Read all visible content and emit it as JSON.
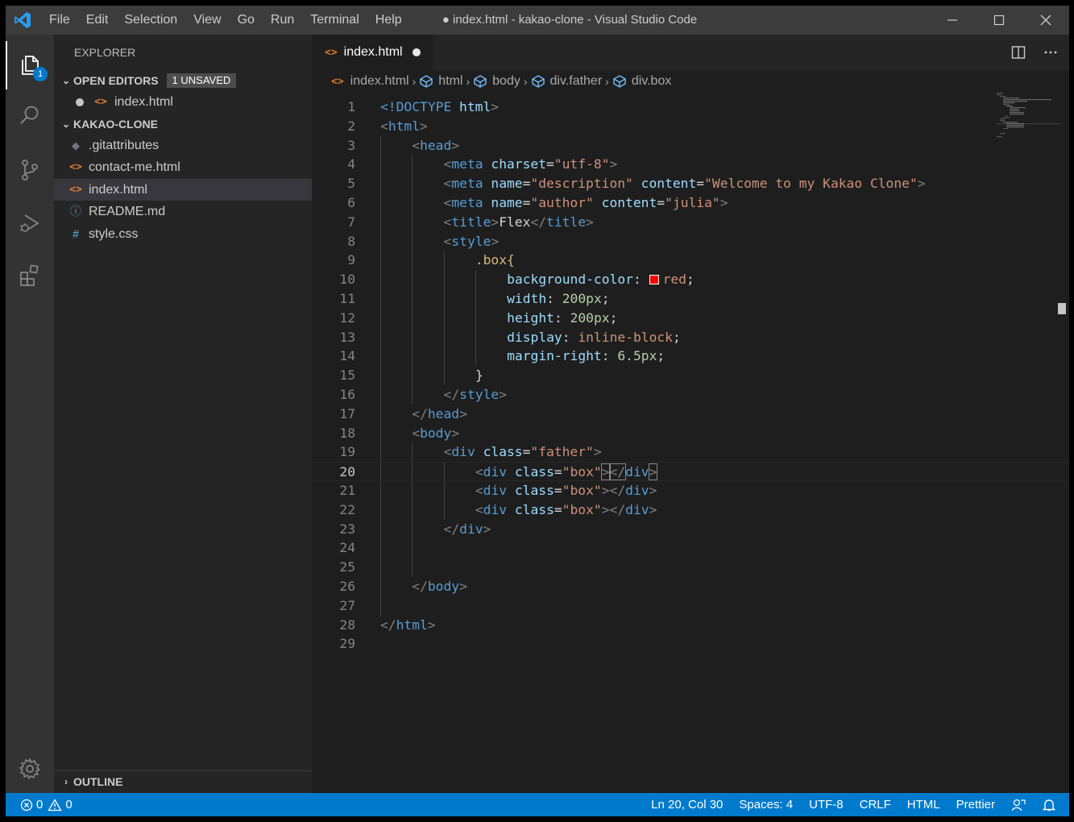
{
  "window": {
    "title": "● index.html - kakao-clone - Visual Studio Code",
    "menu": [
      "File",
      "Edit",
      "Selection",
      "View",
      "Go",
      "Run",
      "Terminal",
      "Help"
    ]
  },
  "activity_bar": {
    "items": [
      "files-icon",
      "search-icon",
      "source-control-icon",
      "run-debug-icon",
      "extensions-icon"
    ],
    "explorer_badge": "1",
    "bottom": "gear-icon"
  },
  "sidebar": {
    "title": "EXPLORER",
    "open_editors": {
      "label": "OPEN EDITORS",
      "badge": "1 UNSAVED",
      "files": [
        {
          "name": "index.html",
          "dirty": true
        }
      ]
    },
    "folder": {
      "label": "KAKAO-CLONE",
      "files": [
        {
          "name": ".gitattributes",
          "icon": "git-file-icon"
        },
        {
          "name": "contact-me.html",
          "icon": "html-file-icon"
        },
        {
          "name": "index.html",
          "icon": "html-file-icon",
          "selected": true
        },
        {
          "name": "README.md",
          "icon": "info-file-icon"
        },
        {
          "name": "style.css",
          "icon": "css-file-icon"
        }
      ]
    },
    "outline_label": "OUTLINE"
  },
  "editor": {
    "tab": {
      "label": "index.html",
      "dirty": true
    },
    "breadcrumb": [
      "index.html",
      "html",
      "body",
      "div.father",
      "div.box"
    ],
    "line_numbers": [
      "1",
      "2",
      "3",
      "4",
      "5",
      "6",
      "7",
      "8",
      "9",
      "10",
      "11",
      "12",
      "13",
      "14",
      "15",
      "16",
      "17",
      "18",
      "19",
      "20",
      "21",
      "22",
      "23",
      "24",
      "25",
      "26",
      "27",
      "28",
      "29"
    ],
    "current_line": 20,
    "code": [
      {
        "t": "<!DOCTYPE",
        "c": "punc-tag"
      },
      {
        "t": "html",
        "c": "attr"
      },
      {
        "t": "html",
        "c": "tag"
      },
      {
        "t": "head",
        "c": "tag"
      },
      {
        "t": "meta",
        "c": "tag"
      },
      {
        "t": "charset",
        "c": "attr"
      },
      {
        "t": "\"utf-8\"",
        "c": "str"
      },
      {
        "t": "name",
        "c": "attr"
      },
      {
        "t": "\"description\"",
        "c": "str"
      },
      {
        "t": "content",
        "c": "attr"
      },
      {
        "t": "\"Welcome to my Kakao Clone\"",
        "c": "str"
      },
      {
        "t": "\"author\"",
        "c": "str"
      },
      {
        "t": "\"julia\"",
        "c": "str"
      },
      {
        "t": "title",
        "c": "tag"
      },
      {
        "t": "Flex",
        "c": "txt"
      },
      {
        "t": "style",
        "c": "tag"
      },
      {
        "t": ".box{",
        "c": "sel"
      },
      {
        "t": "background-color",
        "c": "prop"
      },
      {
        "t": "red",
        "c": "val"
      },
      {
        "t": "width",
        "c": "prop"
      },
      {
        "t": "200px",
        "c": "num"
      },
      {
        "t": "height",
        "c": "prop"
      },
      {
        "t": "display",
        "c": "prop"
      },
      {
        "t": "inline-block",
        "c": "val"
      },
      {
        "t": "margin-right",
        "c": "prop"
      },
      {
        "t": "6.5px",
        "c": "num"
      },
      {
        "t": "}",
        "c": "txt"
      },
      {
        "t": "body",
        "c": "tag"
      },
      {
        "t": "div",
        "c": "tag"
      },
      {
        "t": "class",
        "c": "attr"
      },
      {
        "t": "\"father\"",
        "c": "str"
      },
      {
        "t": "\"box\"",
        "c": "str"
      },
      {
        "t": "<",
        "c": "punc"
      },
      {
        "t": ">",
        "c": "punc"
      },
      {
        "t": "</",
        "c": "punc"
      },
      {
        "t": "=",
        "c": "txt"
      },
      {
        "t": ":",
        "c": "txt"
      },
      {
        "t": ";",
        "c": "txt"
      }
    ],
    "swatch_color": "#ff0000"
  },
  "status_bar": {
    "errors": "0",
    "warnings": "0",
    "position": "Ln 20, Col 30",
    "spaces": "Spaces: 4",
    "encoding": "UTF-8",
    "eol": "CRLF",
    "language": "HTML",
    "formatter": "Prettier"
  },
  "colors": {
    "accent": "#007acc",
    "titlebar": "#3c3c3c",
    "sidebar": "#252526",
    "editor": "#1e1e1e"
  }
}
